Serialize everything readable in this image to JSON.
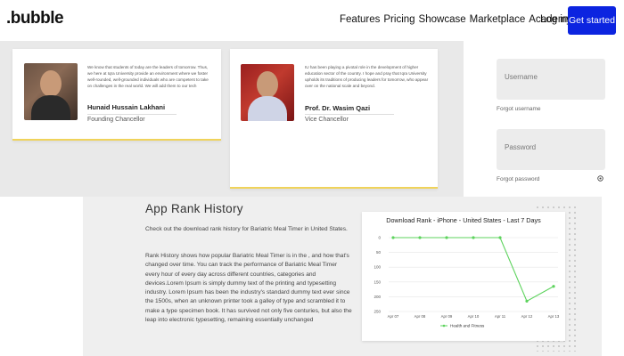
{
  "nav": {
    "logo": ".bubble",
    "links": [
      "Features",
      "Pricing",
      "Showcase",
      "Marketplace",
      "Academy"
    ],
    "login": "Log in",
    "cta": "Get started"
  },
  "testimonials": [
    {
      "quote": "We know that students of today are the leaders of tomorrow. Thus, we here at Iqra University provide an environment where we foster well-rounded, well-grounded individuals who are competent to take on challenges in the real world. We will add them to our tech",
      "name": "Hunaid Hussain Lakhani",
      "role": "Founding Chancellor"
    },
    {
      "quote": "IU has been playing a pivotal role in the development of higher education sector of the country. I hope and pray that Iqra University upholds its traditions of producing leaders for tomorrow, who appear over on the national scale and beyond.",
      "name": "Prof. Dr. Wasim Qazi",
      "role": "Vice Chancellor"
    }
  ],
  "signin": {
    "username_placeholder": "Username",
    "forgot_username": "Forgot username",
    "password_placeholder": "Password",
    "forgot_password": "Forgot password",
    "eye_icon": "eye-icon"
  },
  "rank": {
    "title": "App Rank History",
    "intro": "Check out the download rank history for Bariatric Meal Timer in United States.",
    "body": "Rank History shows how popular Bariatric Meal Timer is in the , and how that's changed over time. You can track the performance of Bariatric Meal Timer every hour of every day across different countries, categories and devices.Lorem Ipsum is simply dummy text of the printing and typesetting industry. Lorem Ipsum has been the industry's standard dummy text ever since the 1500s, when an unknown printer took a galley of type and scrambled it to make a type specimen book. It has survived not only five centuries, but also the leap into electronic typesetting, remaining essentially unchanged"
  },
  "chart_data": {
    "type": "line",
    "title": "Download Rank - iPhone - United States - Last 7 Days",
    "categories": [
      "Apr 07",
      "Apr 08",
      "Apr 09",
      "Apr 10",
      "Apr 11",
      "Apr 12",
      "Apr 13"
    ],
    "series": [
      {
        "name": "Health and Fitness",
        "values": [
          0,
          0,
          0,
          0,
          0,
          215,
          165
        ],
        "color": "#5dd35d"
      }
    ],
    "yticks": [
      "0",
      "50",
      "100",
      "150",
      "200",
      "250"
    ],
    "ylim": [
      0,
      250
    ],
    "y_inverted": true,
    "legend": "bottom"
  }
}
